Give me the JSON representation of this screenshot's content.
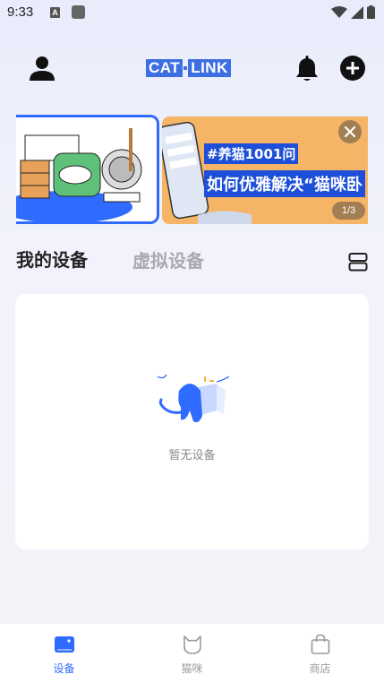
{
  "status_bar": {
    "time": "9:33",
    "a_badge": "A"
  },
  "header": {
    "logo_left": "CAT",
    "logo_right": "LINK",
    "profile_icon": "person-icon",
    "bell_icon": "bell-icon",
    "add_icon": "plus-circle-icon"
  },
  "banner": {
    "hashtag": "#养猫1001问",
    "headline": "如何优雅解决“猫咪卧",
    "indicator": "1/3",
    "close_icon": "close-icon"
  },
  "tabs": {
    "my_devices": "我的设备",
    "virtual_devices": "虚拟设备"
  },
  "device_list": {
    "empty_text": "暂无设备"
  },
  "bottom_nav": {
    "items": [
      {
        "label": "设备",
        "icon": "device-icon",
        "active": true
      },
      {
        "label": "猫咪",
        "icon": "cat-icon",
        "active": false
      },
      {
        "label": "商店",
        "icon": "shopping-bag-icon",
        "active": false
      }
    ]
  },
  "colors": {
    "accent": "#2f6bff",
    "brand": "#3d6fe0",
    "inactive_tab": "#a8a8b0",
    "banner_orange": "#f6b566"
  }
}
